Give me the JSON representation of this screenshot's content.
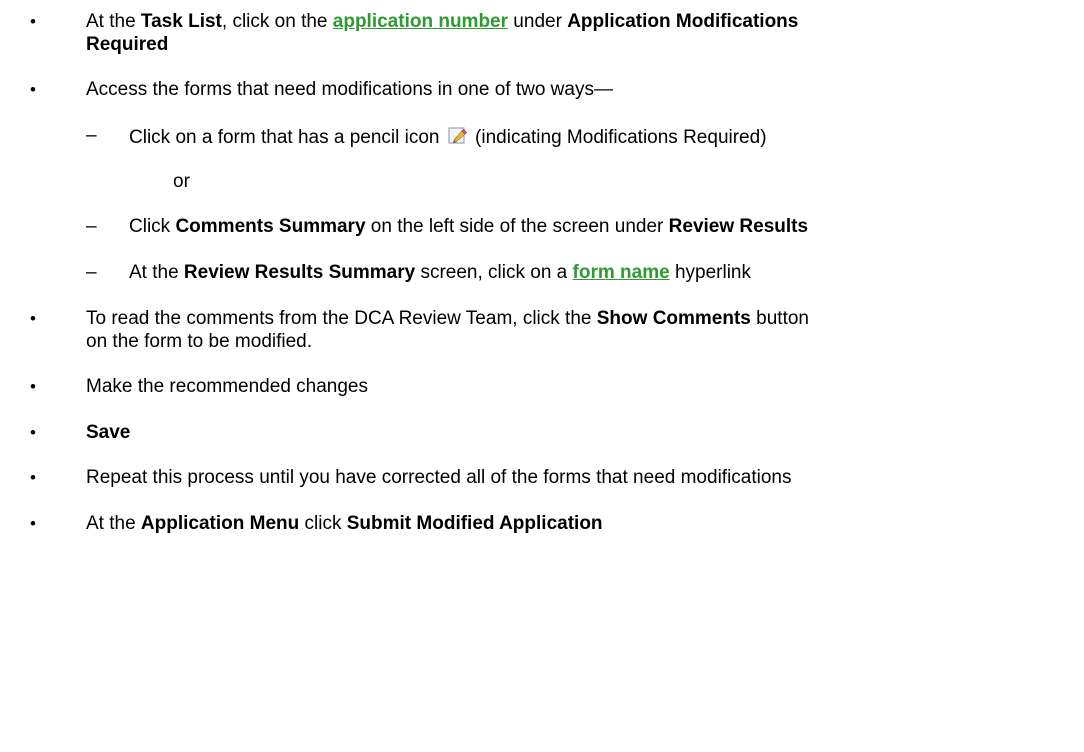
{
  "items": {
    "i1": {
      "p1": "At the ",
      "b1": "Task List",
      "p2": ", click on the ",
      "link": "application number",
      "p3": " under ",
      "b2": "Application Modifications",
      "b3": "Required"
    },
    "i2": {
      "text": "Access the forms that need modifications in one of two ways—"
    },
    "s1": {
      "p1": "Click on a form that has a pencil icon ",
      "p2": " (indicating Modifications Required)",
      "icon": "pencil-icon"
    },
    "or": "or",
    "s2": {
      "p1": "Click ",
      "b1": "Comments Summary",
      "p2": " on the left side of the screen under ",
      "b2": "Review Results"
    },
    "s3": {
      "p1": "At the ",
      "b1": "Review Results Summary",
      "p2": " screen, click on a ",
      "link": "form name",
      "p3": " hyperlink"
    },
    "i3": {
      "p1": "To read the comments from the DCA Review Team, click the ",
      "b1": "Show Comments",
      "p2": " button",
      "line2": "on the form to be modified."
    },
    "i4": {
      "text": "Make the recommended changes"
    },
    "i5": {
      "b1": "Save"
    },
    "i6": {
      "text": "Repeat this process until you have corrected all of the forms that need modifications"
    },
    "i7": {
      "p1": "At the ",
      "b1": "Application Menu",
      "p2": " click ",
      "b2": "Submit Modified Application"
    }
  },
  "symbols": {
    "bullet": "•",
    "dash": "–"
  },
  "colors": {
    "link": "#2f9a2f",
    "text": "#000000"
  }
}
